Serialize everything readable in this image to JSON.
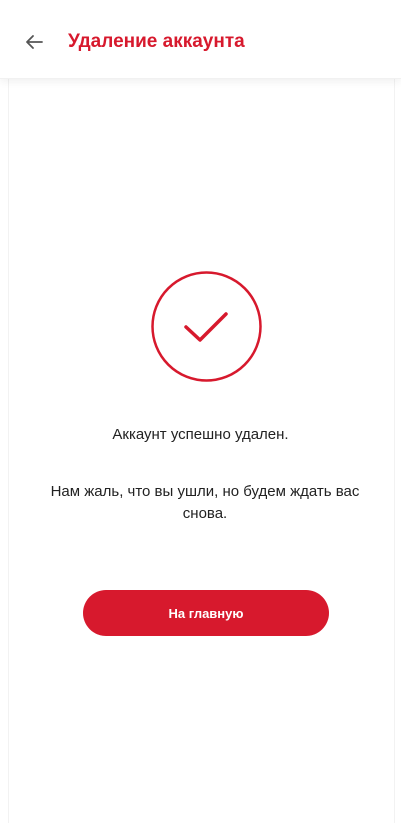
{
  "header": {
    "back_icon": "arrow-left-icon",
    "title": "Удаление аккаунта"
  },
  "status": {
    "icon": "check-circle-icon",
    "message": "Аккаунт успешно удален.",
    "subtitle": "Нам жаль, что вы ушли, но будем ждать вас снова."
  },
  "actions": {
    "home_label": "На главную"
  },
  "colors": {
    "accent": "#d7192d",
    "text": "#222222",
    "background": "#ffffff"
  }
}
